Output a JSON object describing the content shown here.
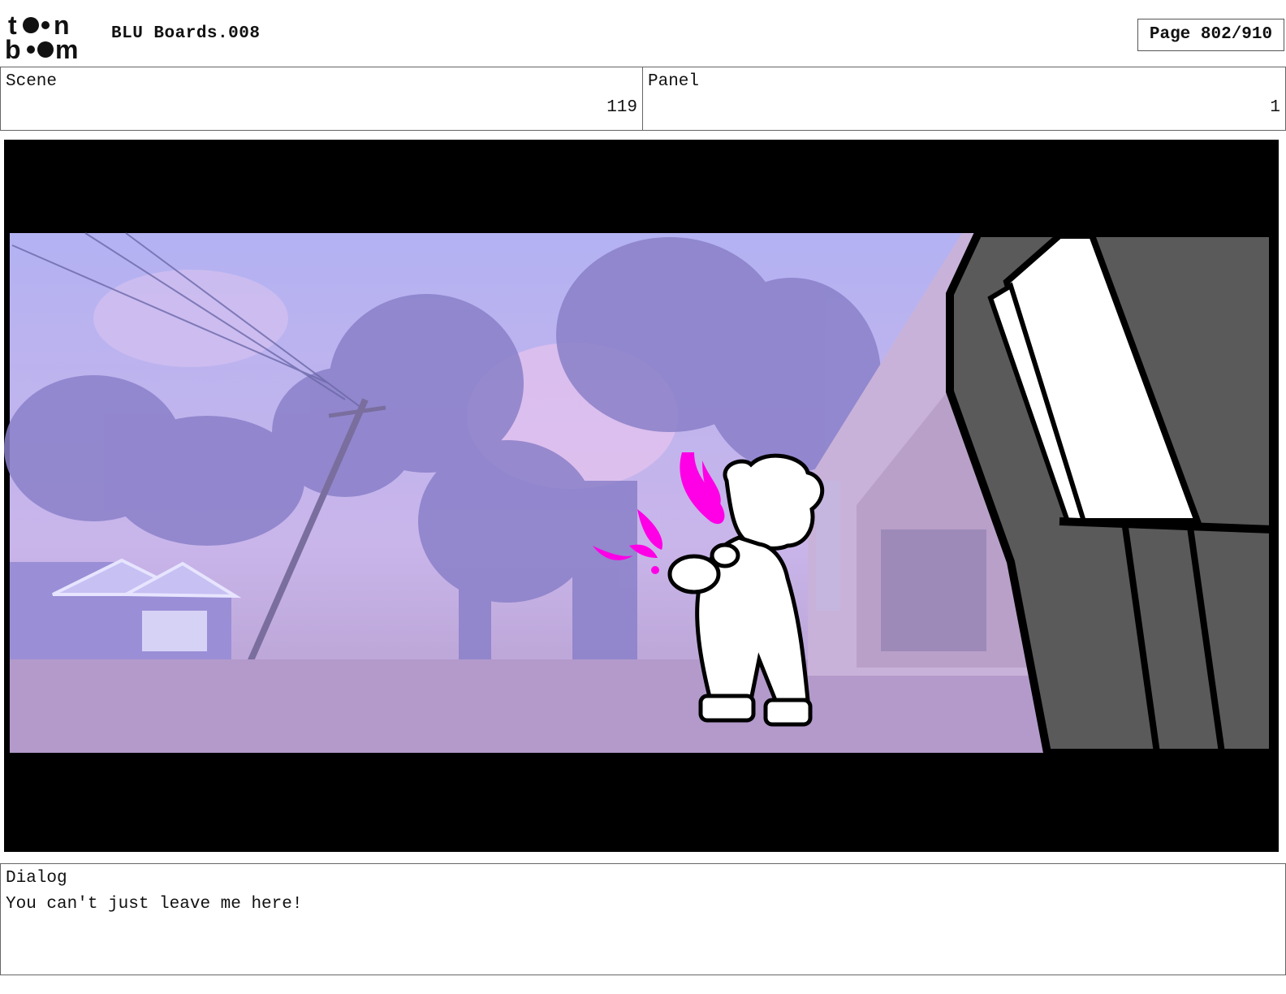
{
  "header": {
    "logo_text": "toon boom",
    "title": "BLU Boards.008",
    "page": "Page 802/910"
  },
  "info": {
    "scene_label": "Scene",
    "scene_value": "119",
    "panel_label": "Panel",
    "panel_value": "1"
  },
  "frame": {
    "letterbox_color": "#000000",
    "sky_color": "#b8b6f0",
    "ground_color": "#b59ccd",
    "accent_color": "#ff00e6"
  },
  "dialog": {
    "label": "Dialog",
    "text": "You can't just leave me here!"
  }
}
